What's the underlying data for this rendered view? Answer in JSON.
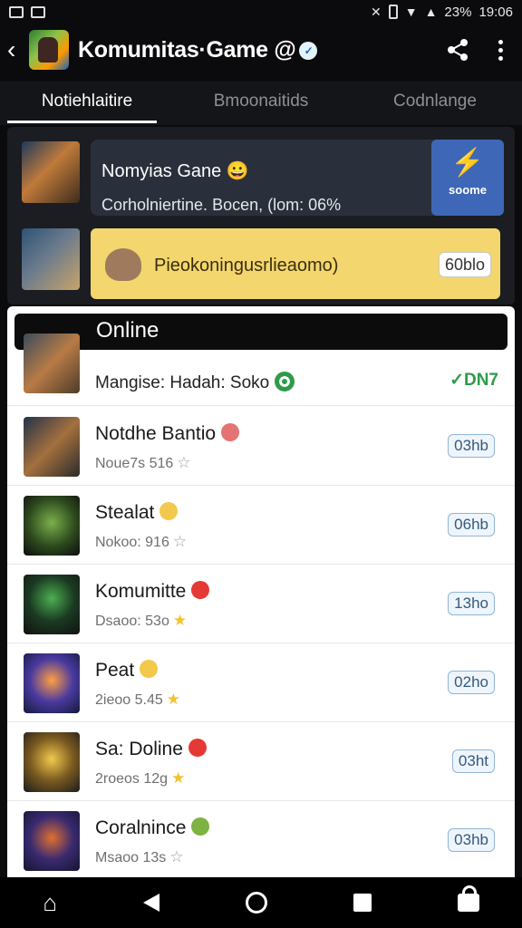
{
  "status_bar": {
    "battery": "23%",
    "time": "19:06"
  },
  "app_bar": {
    "title": "Komumitas·Game",
    "title_suffix": "@"
  },
  "tabs": [
    {
      "label": "Notiehlaitire",
      "active": true
    },
    {
      "label": "Bmoonaitids",
      "active": false
    },
    {
      "label": "Codnlange",
      "active": false
    }
  ],
  "featured": {
    "card1_title": "Nomyias Gane",
    "card1_subtitle": "Corholniertine. Bocen, (lom: 06%",
    "card1_badge": "soome",
    "card2_text": "Pieokoningusrlieaomo)",
    "card2_pill": "60blo"
  },
  "online": {
    "header": "Online",
    "first_row": {
      "text": "Mangise: Hadah: Soko",
      "status": "DN7"
    },
    "rows": [
      {
        "name": "Notdhe Bantio",
        "meta": "Noue7s 516",
        "pill": "03hb",
        "emoji_color": "#e57373",
        "star_color": "#9e9e9e"
      },
      {
        "name": "Stealat",
        "meta": "Nokoo: 916",
        "pill": "06hb",
        "emoji_color": "#f2c94c",
        "star_color": "#9e9e9e"
      },
      {
        "name": "Komumitte",
        "meta": "Dsaoo: 53o",
        "pill": "13ho",
        "emoji_color": "#e53935",
        "star_color": "#f2c230"
      },
      {
        "name": "Peat",
        "meta": "2ieoo 5.45",
        "pill": "02ho",
        "emoji_color": "#f2c94c",
        "star_color": "#f2c230"
      },
      {
        "name": "Sa: Doline",
        "meta": "2roeos 12g",
        "pill": "03ht",
        "emoji_color": "#e53935",
        "star_color": "#f2c230"
      },
      {
        "name": "Coralnince",
        "meta": "Msaoo 13s",
        "pill": "03hb",
        "emoji_color": "#7cb342",
        "star_color": "#9e9e9e"
      }
    ]
  },
  "colors": {
    "background": "#0b0b0d",
    "accent_blue": "#3f67b8",
    "highlight_yellow": "#f3d66d",
    "online_green": "#2e9b4a"
  }
}
